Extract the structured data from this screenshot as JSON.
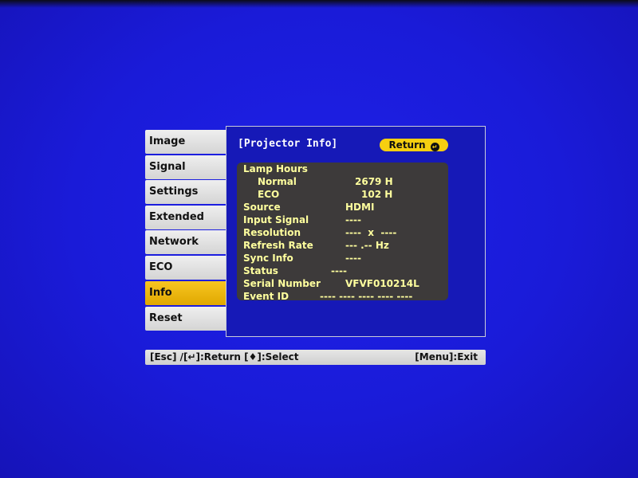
{
  "menu": {
    "items": [
      {
        "label": "Image"
      },
      {
        "label": "Signal"
      },
      {
        "label": "Settings"
      },
      {
        "label": "Extended"
      },
      {
        "label": "Network"
      },
      {
        "label": "ECO"
      },
      {
        "label": "Info"
      },
      {
        "label": "Reset"
      }
    ],
    "selected": "Info"
  },
  "panel": {
    "title": "[Projector Info]",
    "return_label": "Return",
    "return_icon": "return-icon"
  },
  "info": {
    "lamp_hours_label": "Lamp Hours",
    "normal_label": "Normal",
    "normal_value": "2679 H",
    "eco_label": "ECO",
    "eco_value": "102 H",
    "source_label": "Source",
    "source_value": "HDMI",
    "input_signal_label": "Input Signal",
    "input_signal_value": "----",
    "resolution_label": "Resolution",
    "resolution_value": "----  x  ----",
    "refresh_rate_label": "Refresh Rate",
    "refresh_rate_value": "--- .-- Hz",
    "sync_info_label": "Sync Info",
    "sync_info_value": "----",
    "status_label": "Status",
    "status_value": "----",
    "serial_number_label": "Serial Number",
    "serial_number_value": "VFVF010214L",
    "event_id_label": "Event ID",
    "event_id_value": "---- ---- ---- ---- ----"
  },
  "help": {
    "left": "[Esc] /[↵]:Return  [♦]:Select",
    "right": "[Menu]:Exit"
  },
  "colors": {
    "background_blue": "#1a1bd8",
    "panel_blue": "#1619b7",
    "highlight_yellow": "#f7c521",
    "info_text": "#ffff9e",
    "info_box": "#3d3a3a"
  }
}
